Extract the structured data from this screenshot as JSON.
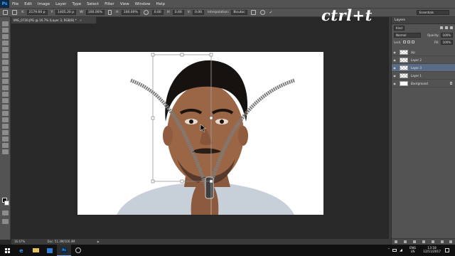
{
  "app": {
    "logo": "Ps"
  },
  "menu": [
    "File",
    "Edit",
    "Image",
    "Layer",
    "Type",
    "Select",
    "Filter",
    "View",
    "Window",
    "Help"
  ],
  "options": {
    "x_label": "X:",
    "x_value": "2179.60 p",
    "y_label": "Y:",
    "y_value": "1405.20 p",
    "w_label": "W:",
    "w_value": "100.00%",
    "h_label": "H:",
    "h_value": "100.00%",
    "rot_value": "0.00",
    "hskew_label": "H:",
    "hskew_value": "0.00",
    "vskew_label": "V:",
    "vskew_value": "0.00",
    "interp_label": "Interpolation:",
    "interp_value": "Bicubic"
  },
  "workspace": "Essentials",
  "watermark": "ctrl+t",
  "document": {
    "tab_title": "IMG_0720.JPG @ 16.7% (Layer 3, RGB/8) *",
    "close": "×"
  },
  "status": {
    "zoom": "16.67%",
    "doc_size": "Doc: 51.3M/100.4M"
  },
  "layers_panel": {
    "tab": "Layers",
    "filter": "Kind",
    "blend_mode": "Normal",
    "opacity_label": "Opacity:",
    "opacity_value": "100%",
    "lock_label": "Lock:",
    "fill_label": "Fill:",
    "fill_value": "100%",
    "layers": [
      {
        "name": "zip",
        "selected": false,
        "italic": false,
        "thumb": "transparent"
      },
      {
        "name": "Layer 2",
        "selected": false,
        "italic": false,
        "thumb": "transparent"
      },
      {
        "name": "Layer 3",
        "selected": true,
        "italic": false,
        "thumb": "transparent"
      },
      {
        "name": "Layer 1",
        "selected": false,
        "italic": false,
        "thumb": "transparent"
      },
      {
        "name": "Background",
        "selected": false,
        "italic": true,
        "thumb": "white"
      }
    ]
  },
  "taskbar": {
    "ime_lang": "ENG",
    "ime_region": "US",
    "time": "13:18",
    "date": "12/11/2017"
  },
  "colors": {
    "accent": "#31a8ff",
    "selection": "#5a6b85"
  }
}
